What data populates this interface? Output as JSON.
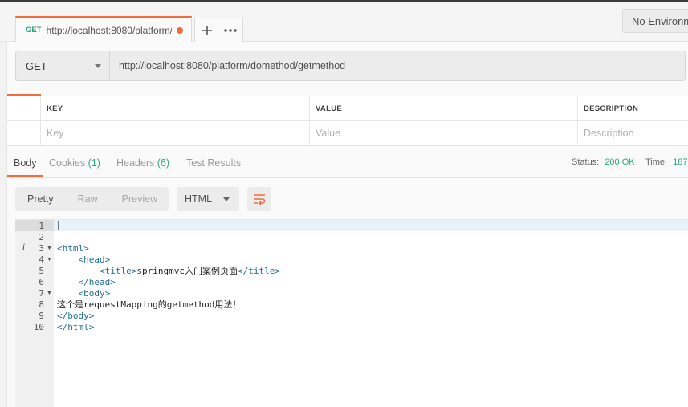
{
  "tab": {
    "method": "GET",
    "url": "http://localhost:8080/platform/d"
  },
  "environment": {
    "label": "No Environm"
  },
  "request": {
    "method": "GET",
    "url": "http://localhost:8080/platform/domethod/getmethod"
  },
  "params": {
    "headers": [
      "KEY",
      "VALUE",
      "DESCRIPTION"
    ],
    "placeholders": [
      "Key",
      "Value",
      "Description"
    ]
  },
  "response_tabs": [
    {
      "label": "Body",
      "count": ""
    },
    {
      "label": "Cookies",
      "count": "(1)"
    },
    {
      "label": "Headers",
      "count": "(6)"
    },
    {
      "label": "Test Results",
      "count": ""
    }
  ],
  "status": {
    "label": "Status:",
    "value": "200 OK",
    "time_label": "Time:",
    "time_value": "187"
  },
  "view": {
    "pretty": "Pretty",
    "raw": "Raw",
    "preview": "Preview",
    "format": "HTML"
  },
  "editor": {
    "line_numbers": [
      "1",
      "2",
      "3",
      "4",
      "5",
      "6",
      "7",
      "8",
      "9",
      "10"
    ],
    "lines": [
      "",
      "",
      "<html>",
      "    <head>",
      "        <title>springmvc入门案例页面</title>",
      "    </head>",
      "    <body>",
      "这个是requestMapping的getmethod用法！",
      "</body>",
      "</html>"
    ]
  },
  "colors": {
    "accent": "#f26b3a",
    "success": "#2aa876",
    "tag": "#1f6f8b"
  }
}
